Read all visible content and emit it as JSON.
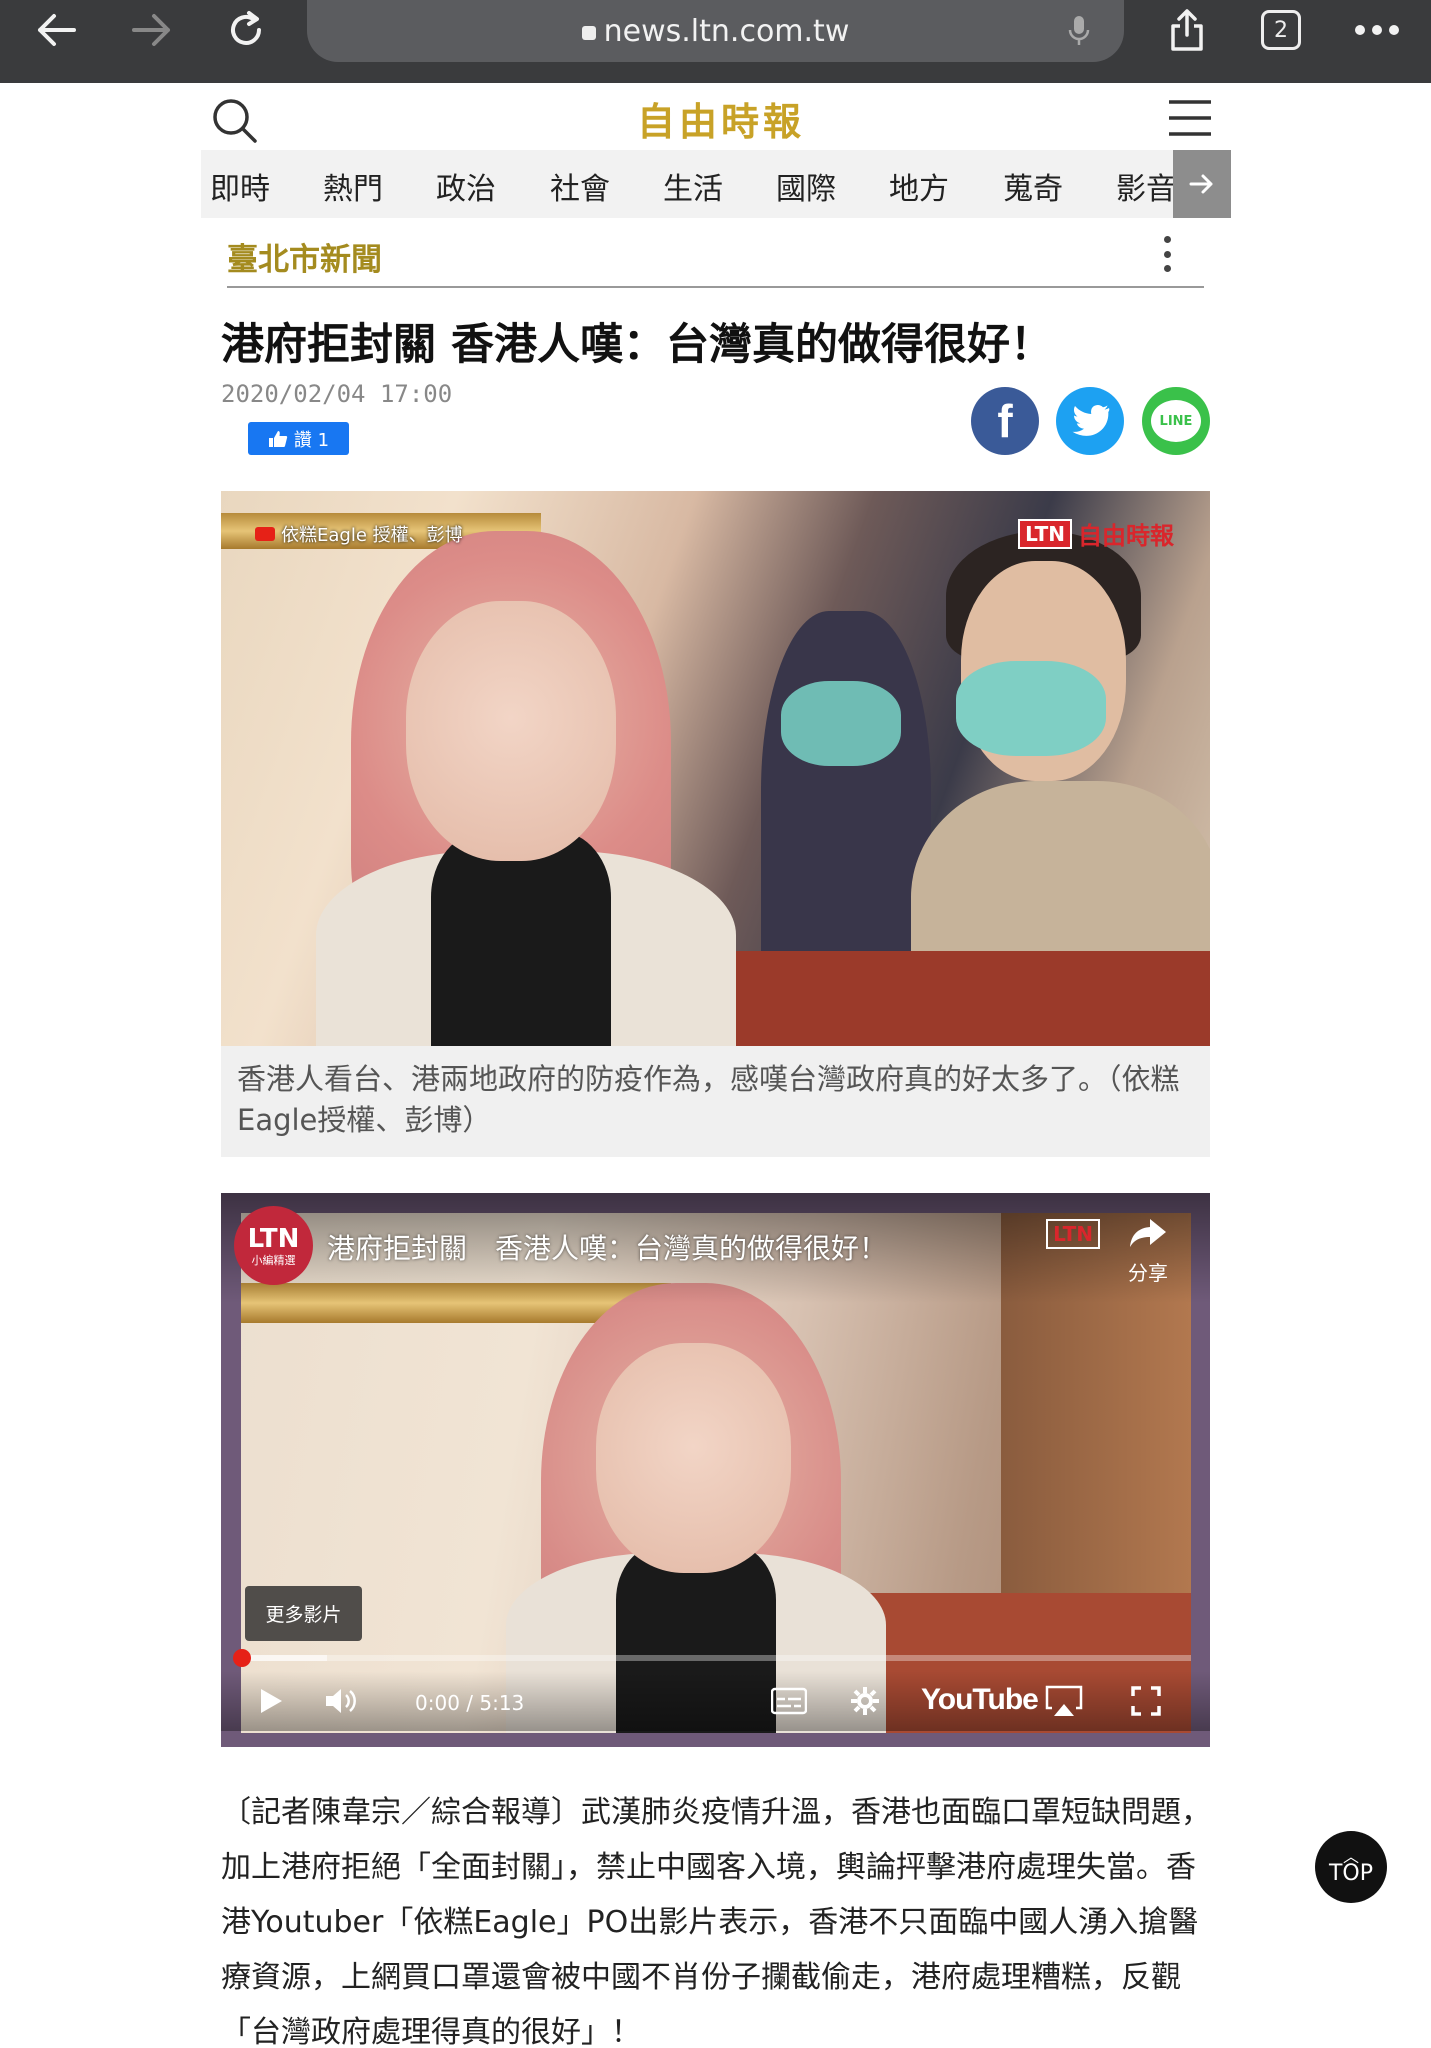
{
  "browser": {
    "url": "news.ltn.com.tw",
    "tab_count": "2"
  },
  "site": {
    "logo": "自由時報",
    "nav": [
      "即時",
      "熱門",
      "政治",
      "社會",
      "生活",
      "國際",
      "地方",
      "蒐奇",
      "影音"
    ],
    "section": "臺北市新聞"
  },
  "article": {
    "headline": "港府拒封關 香港人嘆：台灣真的做得很好！",
    "date": "2020/02/04 17:00",
    "like_label": "讚 1",
    "share": {
      "facebook": "f",
      "line": "LINE"
    },
    "photo": {
      "source_watermark": "依糕Eagle 授權、彭博",
      "ltn_box": "LTN",
      "ltn_text": "自由時報",
      "caption": "香港人看台、港兩地政府的防疫作為，感嘆台灣政府真的好太多了。（依糕Eagle授權、彭博）"
    },
    "video": {
      "channel_avatar_top": "LTN",
      "channel_avatar_bottom": "小編精選",
      "title": "港府拒封關　香港人嘆：台灣真的做得很好！",
      "share_label": "分享",
      "more_videos": "更多影片",
      "time": "0:00 / 5:13",
      "youtube_logo": "YouTube",
      "progress_buffered_fraction": 0.09
    },
    "body": "〔記者陳韋宗／綜合報導〕武漢肺炎疫情升溫，香港也面臨口罩短缺問題，加上港府拒絕「全面封關」，禁止中國客入境，輿論抨擊港府處理失當。香港Youtuber「依糕Eagle」PO出影片表示，香港不只面臨中國人湧入搶醫療資源，上網買口罩還會被中國不肖份子攔截偷走，港府處理糟糕，反觀「台灣政府處理得真的很好」！"
  },
  "top_button": "TOP",
  "colors": {
    "chrome": "#3a3b3d",
    "logo_gold": "#c8a227",
    "section_gold": "#a48b1f",
    "facebook": "#3a5a98",
    "twitter": "#1da1f2",
    "line": "#3ac14a",
    "youtube_red": "#e62117"
  }
}
